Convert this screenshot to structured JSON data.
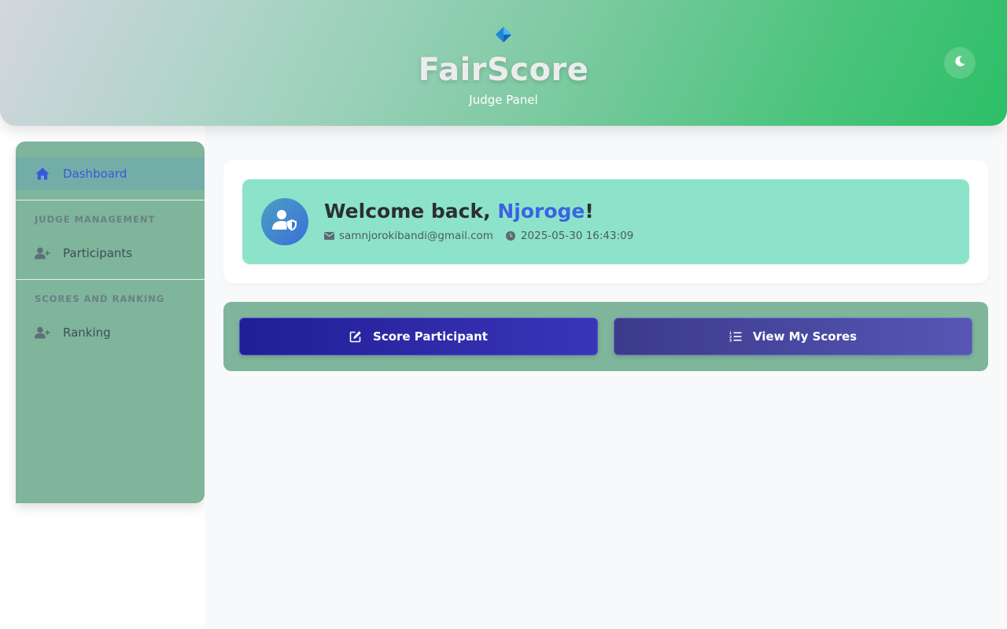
{
  "header": {
    "title": "FairScore",
    "subtitle": "Judge Panel",
    "logo_icon": "diamond-icon",
    "theme_toggle_icon": "moon-icon"
  },
  "sidebar": {
    "items": [
      {
        "label": "Dashboard",
        "icon": "home-icon",
        "active": true
      },
      {
        "label": "Participants",
        "icon": "user-plus-icon",
        "active": false
      },
      {
        "label": "Ranking",
        "icon": "user-plus-icon",
        "active": false
      }
    ],
    "sections": [
      "JUDGE MANAGEMENT",
      "SCORES AND RANKING"
    ]
  },
  "welcome": {
    "greeting": "Welcome back, ",
    "name": "Njoroge",
    "suffix": "!",
    "email": "samnjorokibandi@gmail.com",
    "timestamp": "2025-05-30 16:43:09",
    "avatar_icon": "user-shield-icon"
  },
  "actions": {
    "score_label": "Score Participant",
    "score_icon": "edit-icon",
    "view_label": "View My Scores",
    "view_icon": "list-ordered-icon"
  },
  "colors": {
    "accent": "#3a63e4",
    "header_gradient_start": "#d3d6de",
    "header_gradient_end": "#2dbf67",
    "sidebar_bg": "#7fb59a",
    "welcome_bg": "#8de3c9"
  }
}
